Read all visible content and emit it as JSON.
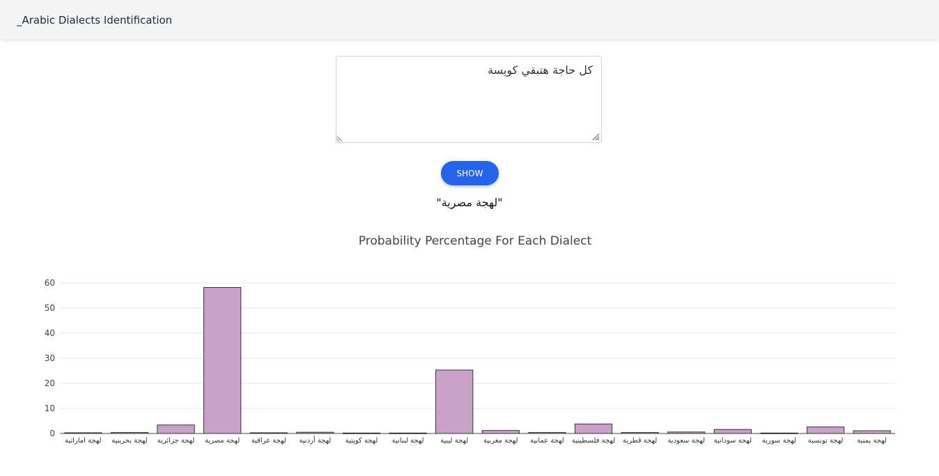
{
  "navbar": {
    "brand": "_Arabic Dialects Identification"
  },
  "input": {
    "value": "كل حاجة هتبقي كويسة"
  },
  "button": {
    "label": "SHOW"
  },
  "result": {
    "text": "\"لهجة مصرية\""
  },
  "chart_data": {
    "type": "bar",
    "title": "Probability Percentage For Each Dialect",
    "categories": [
      "لهجة اماراتية",
      "لهجة بحرينية",
      "لهجة جزائرية",
      "لهجة مصرية",
      "لهجة عراقية",
      "لهجة أردنية",
      "لهجة كويتية",
      "لهجة لبنانية",
      "لهجة ليبية",
      "لهجة مغربية",
      "لهجة عمانية",
      "لهجة فلسطينية",
      "لهجة قطرية",
      "لهجة سعودية",
      "لهجة سودانية",
      "لهجة سورية",
      "لهجة تونسية",
      "لهجة يمنية"
    ],
    "values": [
      0.3,
      0.4,
      3.4,
      58.2,
      0.3,
      0.5,
      0.2,
      0.2,
      25.3,
      1.2,
      0.4,
      3.8,
      0.4,
      0.6,
      1.6,
      0.2,
      2.6,
      1.1
    ],
    "ylim": [
      0,
      60
    ],
    "yticks": [
      0,
      10,
      20,
      30,
      40,
      50,
      60
    ],
    "grid": true,
    "bar_color": "#c8a2c8",
    "bar_edge": "#333333"
  }
}
